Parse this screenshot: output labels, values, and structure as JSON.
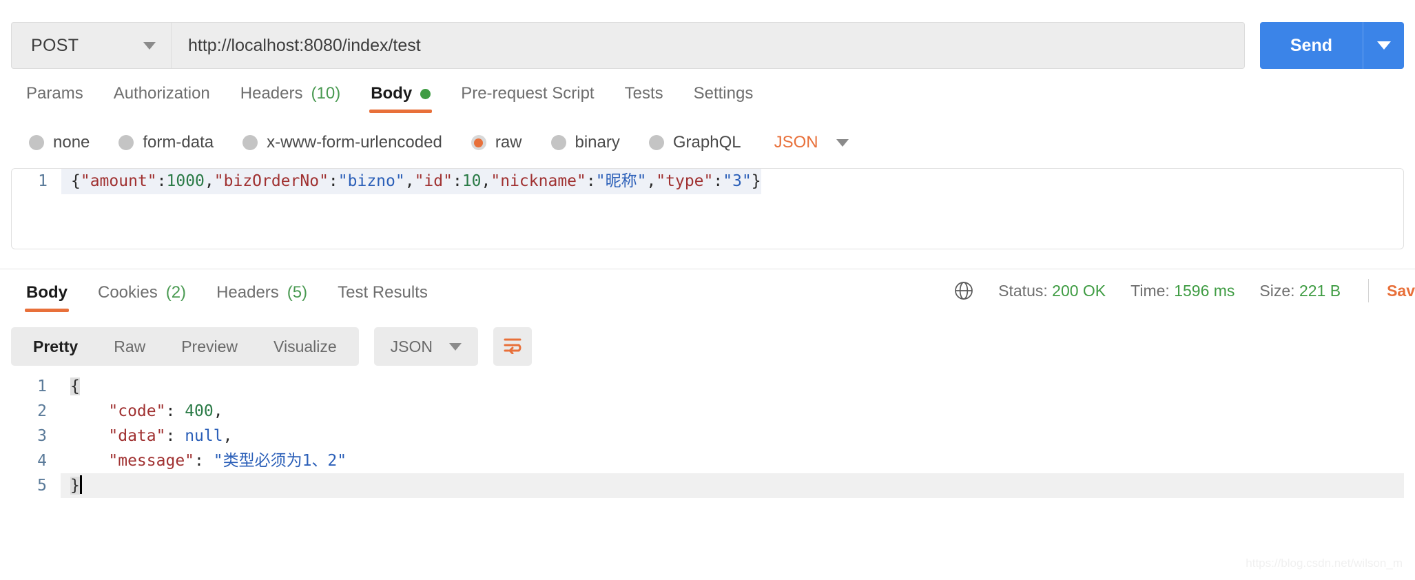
{
  "request": {
    "method": "POST",
    "url": "http://localhost:8080/index/test",
    "send_label": "Send",
    "tabs": [
      {
        "label": "Params",
        "count": ""
      },
      {
        "label": "Authorization",
        "count": ""
      },
      {
        "label": "Headers",
        "count": "(10)"
      },
      {
        "label": "Body",
        "count": ""
      },
      {
        "label": "Pre-request Script",
        "count": ""
      },
      {
        "label": "Tests",
        "count": ""
      },
      {
        "label": "Settings",
        "count": ""
      }
    ],
    "body_types": [
      "none",
      "form-data",
      "x-www-form-urlencoded",
      "raw",
      "binary",
      "GraphQL"
    ],
    "selected_body_type": "raw",
    "raw_format": "JSON",
    "body_line_number": "1",
    "body_tokens": [
      {
        "t": "{",
        "c": "punct"
      },
      {
        "t": "\"amount\"",
        "c": "key"
      },
      {
        "t": ":",
        "c": "punct"
      },
      {
        "t": "1000",
        "c": "num"
      },
      {
        "t": ",",
        "c": "punct"
      },
      {
        "t": "\"bizOrderNo\"",
        "c": "key"
      },
      {
        "t": ":",
        "c": "punct"
      },
      {
        "t": "\"bizno\"",
        "c": "str"
      },
      {
        "t": ",",
        "c": "punct"
      },
      {
        "t": "\"id\"",
        "c": "key"
      },
      {
        "t": ":",
        "c": "punct"
      },
      {
        "t": "10",
        "c": "num"
      },
      {
        "t": ",",
        "c": "punct"
      },
      {
        "t": "\"nickname\"",
        "c": "key"
      },
      {
        "t": ":",
        "c": "punct"
      },
      {
        "t": "\"昵称\"",
        "c": "str"
      },
      {
        "t": ",",
        "c": "punct"
      },
      {
        "t": "\"type\"",
        "c": "key"
      },
      {
        "t": ":",
        "c": "punct"
      },
      {
        "t": "\"3\"",
        "c": "str"
      },
      {
        "t": "}",
        "c": "punct"
      }
    ]
  },
  "response": {
    "tabs": [
      {
        "label": "Body",
        "count": ""
      },
      {
        "label": "Cookies",
        "count": "(2)"
      },
      {
        "label": "Headers",
        "count": "(5)"
      },
      {
        "label": "Test Results",
        "count": ""
      }
    ],
    "status_label": "Status:",
    "status_value": "200 OK",
    "time_label": "Time:",
    "time_value": "1596 ms",
    "size_label": "Size:",
    "size_value": "221 B",
    "save_label": "Sav",
    "view_modes": [
      "Pretty",
      "Raw",
      "Preview",
      "Visualize"
    ],
    "selected_view_mode": "Pretty",
    "format": "JSON",
    "lines": [
      {
        "num": "1",
        "tokens": [
          {
            "t": "{",
            "c": "brace"
          }
        ]
      },
      {
        "num": "2",
        "tokens": [
          {
            "t": "    ",
            "c": "punct"
          },
          {
            "t": "\"code\"",
            "c": "key"
          },
          {
            "t": ": ",
            "c": "punct"
          },
          {
            "t": "400",
            "c": "num"
          },
          {
            "t": ",",
            "c": "punct"
          }
        ]
      },
      {
        "num": "3",
        "tokens": [
          {
            "t": "    ",
            "c": "punct"
          },
          {
            "t": "\"data\"",
            "c": "key"
          },
          {
            "t": ": ",
            "c": "punct"
          },
          {
            "t": "null",
            "c": "null"
          },
          {
            "t": ",",
            "c": "punct"
          }
        ]
      },
      {
        "num": "4",
        "tokens": [
          {
            "t": "    ",
            "c": "punct"
          },
          {
            "t": "\"message\"",
            "c": "key"
          },
          {
            "t": ": ",
            "c": "punct"
          },
          {
            "t": "\"类型必须为1、2\"",
            "c": "str"
          }
        ]
      },
      {
        "num": "5",
        "tokens": [
          {
            "t": "}",
            "c": "brace"
          }
        ]
      }
    ]
  },
  "watermark": "https://blog.csdn.net/wilson_m",
  "colors": {
    "accent_orange": "#e8703a",
    "send_blue": "#3b84e8",
    "success_green": "#3f9c43"
  }
}
